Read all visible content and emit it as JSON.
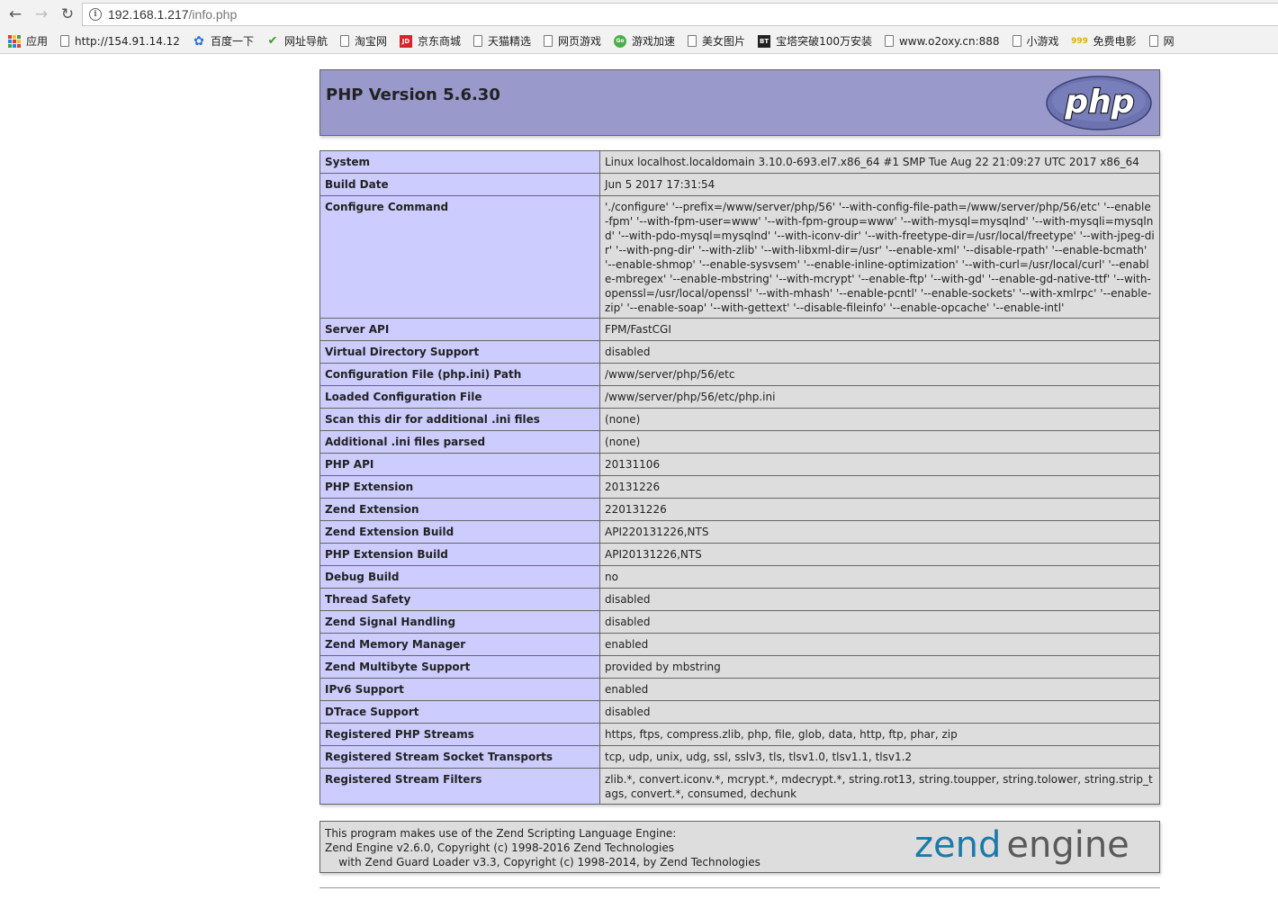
{
  "browser": {
    "url_host": "192.168.1.217",
    "url_path": "/info.php",
    "bookmarks": [
      {
        "label": "应用",
        "icon": "apps-grid-icon"
      },
      {
        "label": "http://154.91.14.12",
        "icon": "page-icon"
      },
      {
        "label": "百度一下",
        "icon": "baidu-paw-icon"
      },
      {
        "label": "网址导航",
        "icon": "hao-check-icon"
      },
      {
        "label": "淘宝网",
        "icon": "page-icon"
      },
      {
        "label": "京东商城",
        "icon": "jd-icon"
      },
      {
        "label": "天猫精选",
        "icon": "page-icon"
      },
      {
        "label": "网页游戏",
        "icon": "page-icon"
      },
      {
        "label": "游戏加速",
        "icon": "game-icon"
      },
      {
        "label": "美女图片",
        "icon": "page-icon"
      },
      {
        "label": "宝塔突破100万安装",
        "icon": "bt-icon"
      },
      {
        "label": "www.o2oxy.cn:888",
        "icon": "page-icon"
      },
      {
        "label": "小游戏",
        "icon": "page-icon"
      },
      {
        "label": "免费电影",
        "icon": "999-icon"
      },
      {
        "label": "网",
        "icon": "page-icon"
      }
    ]
  },
  "header": {
    "title": "PHP Version 5.6.30",
    "logo_text": "php"
  },
  "info_rows": [
    {
      "key": "System",
      "value": "Linux localhost.localdomain 3.10.0-693.el7.x86_64 #1 SMP Tue Aug 22 21:09:27 UTC 2017 x86_64"
    },
    {
      "key": "Build Date",
      "value": "Jun 5 2017 17:31:54"
    },
    {
      "key": "Configure Command",
      "value": "'./configure' '--prefix=/www/server/php/56' '--with-config-file-path=/www/server/php/56/etc' '--enable-fpm' '--with-fpm-user=www' '--with-fpm-group=www' '--with-mysql=mysqlnd' '--with-mysqli=mysqlnd' '--with-pdo-mysql=mysqlnd' '--with-iconv-dir' '--with-freetype-dir=/usr/local/freetype' '--with-jpeg-dir' '--with-png-dir' '--with-zlib' '--with-libxml-dir=/usr' '--enable-xml' '--disable-rpath' '--enable-bcmath' '--enable-shmop' '--enable-sysvsem' '--enable-inline-optimization' '--with-curl=/usr/local/curl' '--enable-mbregex' '--enable-mbstring' '--with-mcrypt' '--enable-ftp' '--with-gd' '--enable-gd-native-ttf' '--with-openssl=/usr/local/openssl' '--with-mhash' '--enable-pcntl' '--enable-sockets' '--with-xmlrpc' '--enable-zip' '--enable-soap' '--with-gettext' '--disable-fileinfo' '--enable-opcache' '--enable-intl'"
    },
    {
      "key": "Server API",
      "value": "FPM/FastCGI"
    },
    {
      "key": "Virtual Directory Support",
      "value": "disabled"
    },
    {
      "key": "Configuration File (php.ini) Path",
      "value": "/www/server/php/56/etc"
    },
    {
      "key": "Loaded Configuration File",
      "value": "/www/server/php/56/etc/php.ini"
    },
    {
      "key": "Scan this dir for additional .ini files",
      "value": "(none)"
    },
    {
      "key": "Additional .ini files parsed",
      "value": "(none)"
    },
    {
      "key": "PHP API",
      "value": "20131106"
    },
    {
      "key": "PHP Extension",
      "value": "20131226"
    },
    {
      "key": "Zend Extension",
      "value": "220131226"
    },
    {
      "key": "Zend Extension Build",
      "value": "API220131226,NTS"
    },
    {
      "key": "PHP Extension Build",
      "value": "API20131226,NTS"
    },
    {
      "key": "Debug Build",
      "value": "no"
    },
    {
      "key": "Thread Safety",
      "value": "disabled"
    },
    {
      "key": "Zend Signal Handling",
      "value": "disabled"
    },
    {
      "key": "Zend Memory Manager",
      "value": "enabled"
    },
    {
      "key": "Zend Multibyte Support",
      "value": "provided by mbstring"
    },
    {
      "key": "IPv6 Support",
      "value": "enabled"
    },
    {
      "key": "DTrace Support",
      "value": "disabled"
    },
    {
      "key": "Registered PHP Streams",
      "value": "https, ftps, compress.zlib, php, file, glob, data, http, ftp, phar, zip"
    },
    {
      "key": "Registered Stream Socket Transports",
      "value": "tcp, udp, unix, udg, ssl, sslv3, tls, tlsv1.0, tlsv1.1, tlsv1.2"
    },
    {
      "key": "Registered Stream Filters",
      "value": "zlib.*, convert.iconv.*, mcrypt.*, mdecrypt.*, string.rot13, string.toupper, string.tolower, string.strip_tags, convert.*, consumed, dechunk"
    }
  ],
  "zend": {
    "lines": [
      "This program makes use of the Zend Scripting Language Engine:",
      "Zend Engine v2.6.0, Copyright (c) 1998-2016 Zend Technologies",
      "    with Zend Guard Loader v3.3, Copyright (c) 1998-2014, by Zend Technologies"
    ],
    "logo_text": "zend engine"
  },
  "colors": {
    "header_bg": "#9999cc",
    "key_bg": "#ccccff",
    "value_bg": "#dddddd",
    "zend_blue": "#1b7aa8",
    "zend_gray": "#5a5a5a"
  }
}
